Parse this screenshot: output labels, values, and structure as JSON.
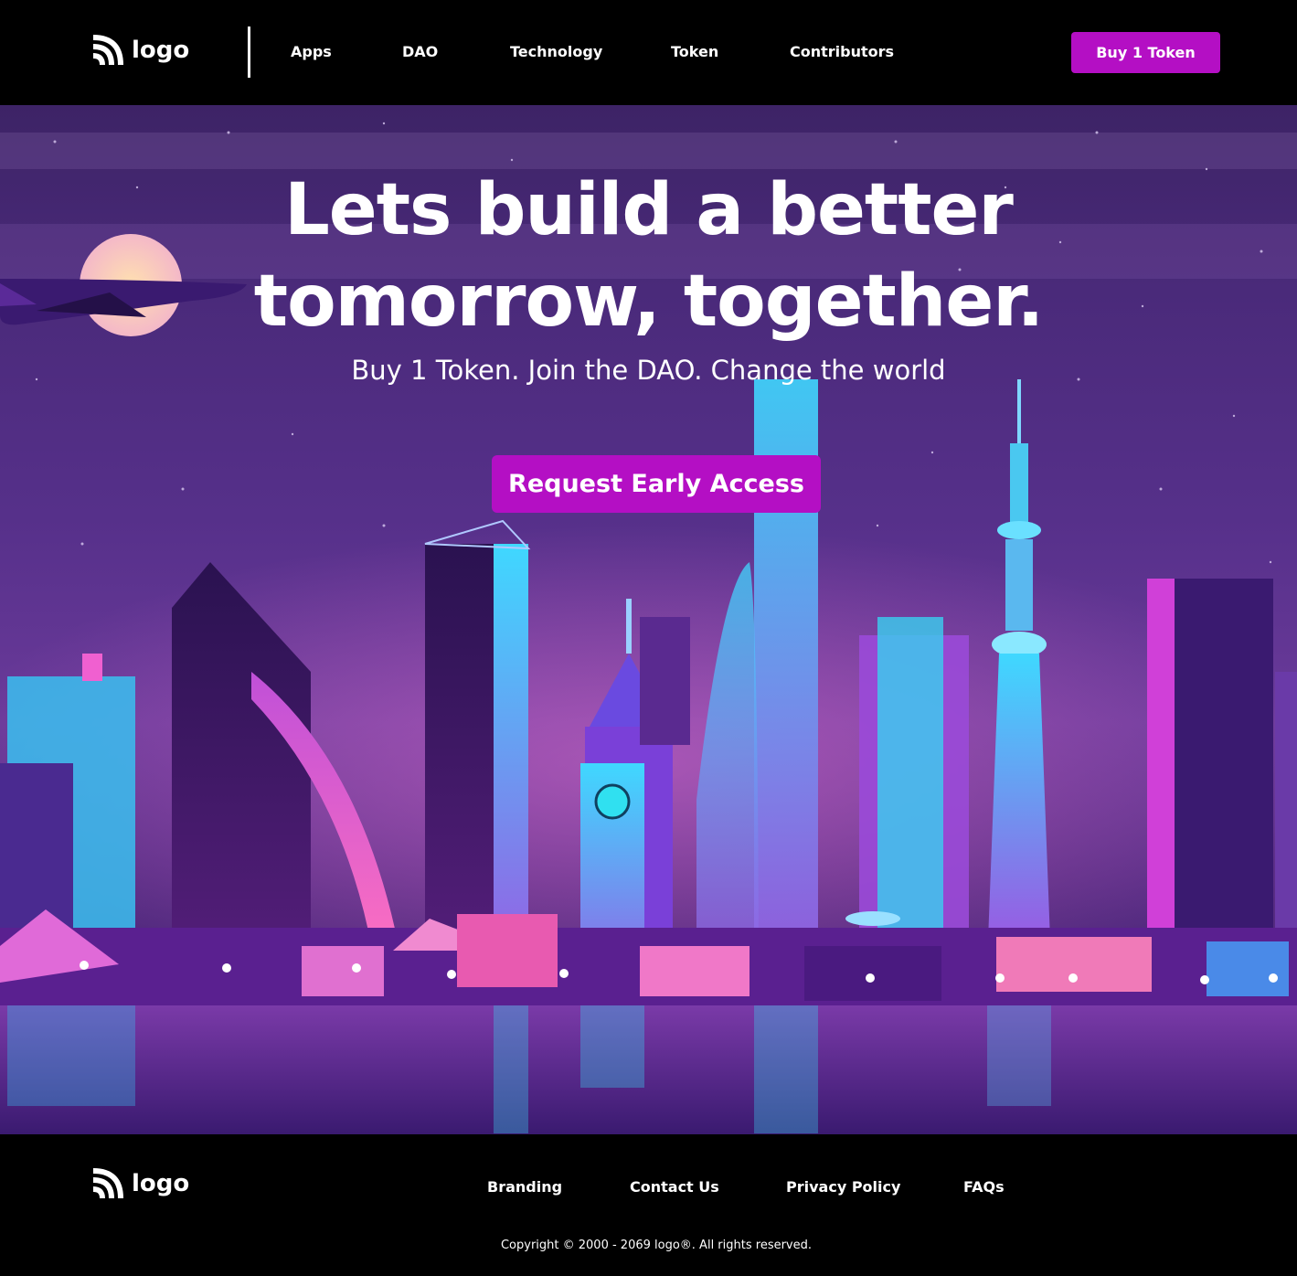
{
  "header": {
    "logo_text": "logo",
    "nav": [
      {
        "label": "Apps"
      },
      {
        "label": "DAO"
      },
      {
        "label": "Technology"
      },
      {
        "label": "Token"
      },
      {
        "label": "Contributors"
      }
    ],
    "cta_label": "Buy 1 Token"
  },
  "hero": {
    "title_line1": "Lets build a better",
    "title_line2": "tomorrow, together.",
    "subtitle": "Buy 1 Token. Join the DAO. Change the world",
    "cta_label": "Request Early Access"
  },
  "footer": {
    "logo_text": "logo",
    "links": [
      {
        "label": "Branding"
      },
      {
        "label": "Contact Us"
      },
      {
        "label": "Privacy Policy"
      },
      {
        "label": "FAQs"
      }
    ],
    "copyright": "Copyright © 2000 - 2069 logo®. All rights reserved."
  },
  "colors": {
    "accent": "#b40fc4",
    "background": "#000000",
    "text": "#ffffff"
  },
  "icons": {
    "logo_icon": "signal-waves-icon"
  }
}
